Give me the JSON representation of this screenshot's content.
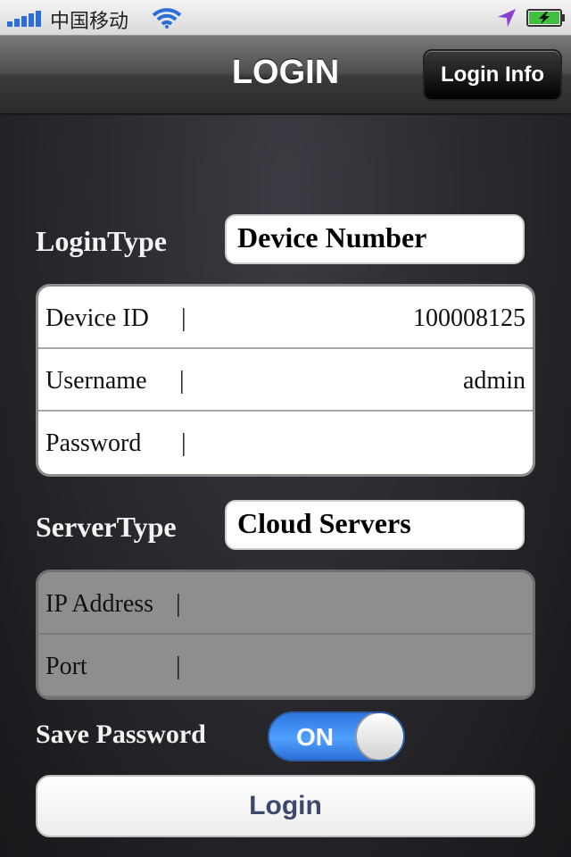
{
  "status_bar": {
    "carrier": "中国移动",
    "icons": [
      "signal-bars-icon",
      "wifi-icon",
      "location-arrow-icon",
      "battery-charging-icon"
    ]
  },
  "nav": {
    "title": "LOGIN",
    "right_button": "Login Info"
  },
  "login_type": {
    "label": "LoginType",
    "value": "Device Number"
  },
  "credentials": {
    "rows": [
      {
        "label": "Device ID",
        "value": "100008125"
      },
      {
        "label": "Username",
        "value": "admin"
      },
      {
        "label": "Password",
        "value": ""
      }
    ]
  },
  "server_type": {
    "label": "ServerType",
    "value": "Cloud Servers"
  },
  "server": {
    "rows": [
      {
        "label": "IP Address",
        "value": ""
      },
      {
        "label": "Port",
        "value": ""
      }
    ]
  },
  "save_password": {
    "label": "Save Password",
    "toggle_text": "ON",
    "on": true
  },
  "login_button": "Login",
  "colors": {
    "toggle_on": "#3b8cf0",
    "login_text": "#3b4a6b"
  }
}
